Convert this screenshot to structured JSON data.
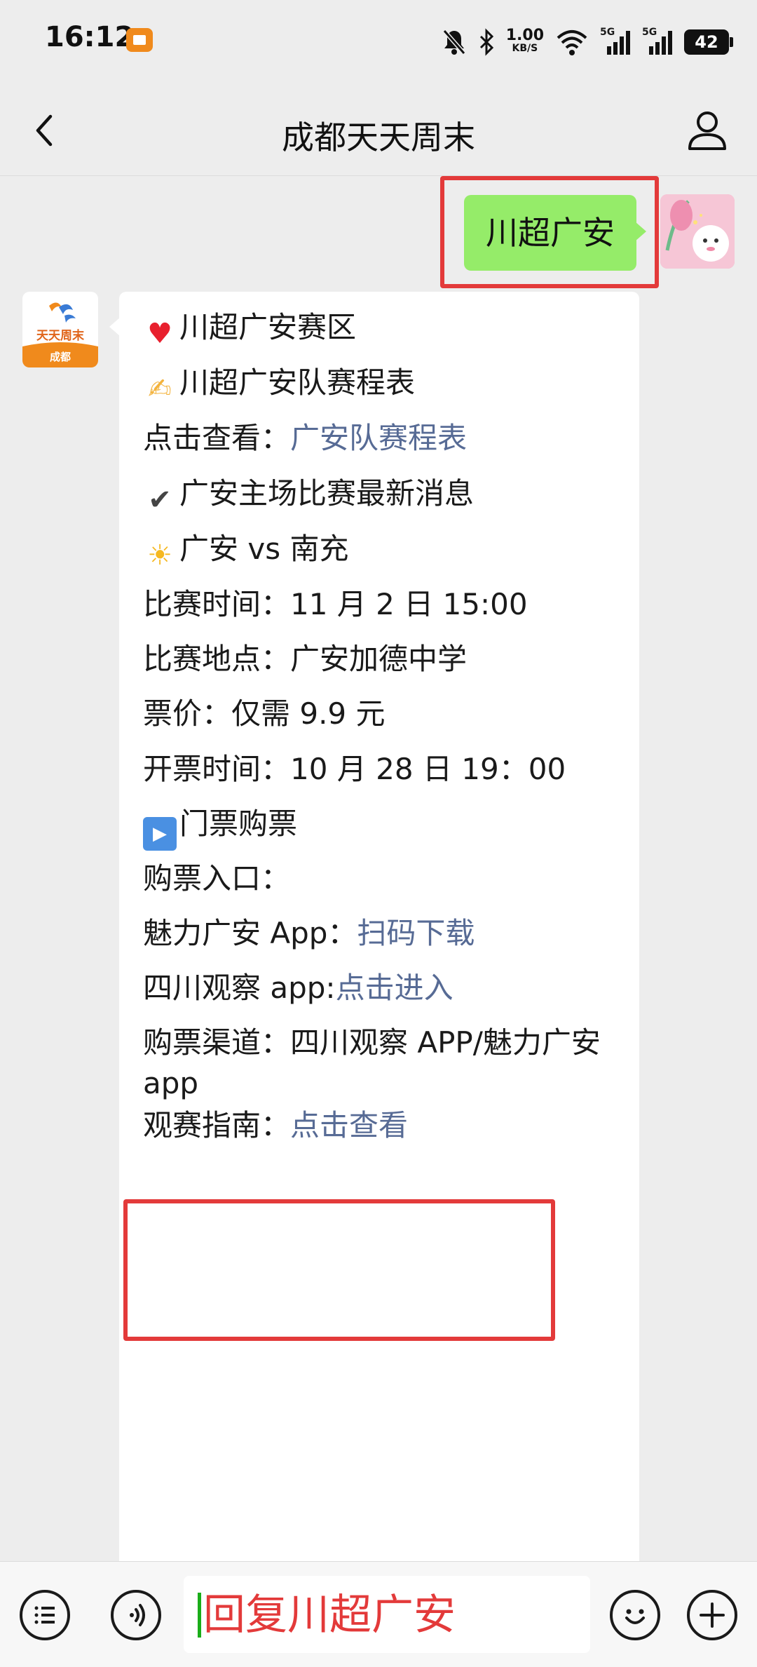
{
  "status_bar": {
    "time": "16:12",
    "net_speed_value": "1.00",
    "net_speed_unit": "KB/S",
    "signal_1_label": "5G",
    "signal_2_label": "5G",
    "battery": "42"
  },
  "header": {
    "title": "成都天天周末"
  },
  "bot": {
    "avatar_text_top": "天天周末",
    "avatar_text_bottom": "成都"
  },
  "chat": {
    "user_message": "川超广安",
    "lines": {
      "l1_text": "川超广安赛区",
      "l2_text": "川超广安队赛程表",
      "l3_prefix": "点击查看：",
      "l3_link": "广安队赛程表",
      "l4_text": "广安主场比赛最新消息",
      "l5_text": "广安 vs 南充",
      "l6_text": "比赛时间：11 月 2 日 15:00",
      "l7_text": "比赛地点：广安加德中学",
      "l8_text": "票价：仅需 9.9 元",
      "l9_text": "开票时间：10 月 28 日 19：00",
      "l10_text": "门票购票",
      "l11_text": "购票入口：",
      "l12_prefix": "魅力广安 App：",
      "l12_link": "扫码下载",
      "l13_prefix": "四川观察 app:",
      "l13_link": "点击进入",
      "l14_text": "购票渠道：四川观察 APP/魅力广安 app",
      "l15_prefix": "观赛指南：",
      "l15_link": "点击查看"
    }
  },
  "input": {
    "text": "回复川超广安"
  },
  "colors": {
    "user_bubble": "#95ec69",
    "link": "#576b95",
    "highlight": "#e33a3a",
    "background": "#ededed"
  }
}
